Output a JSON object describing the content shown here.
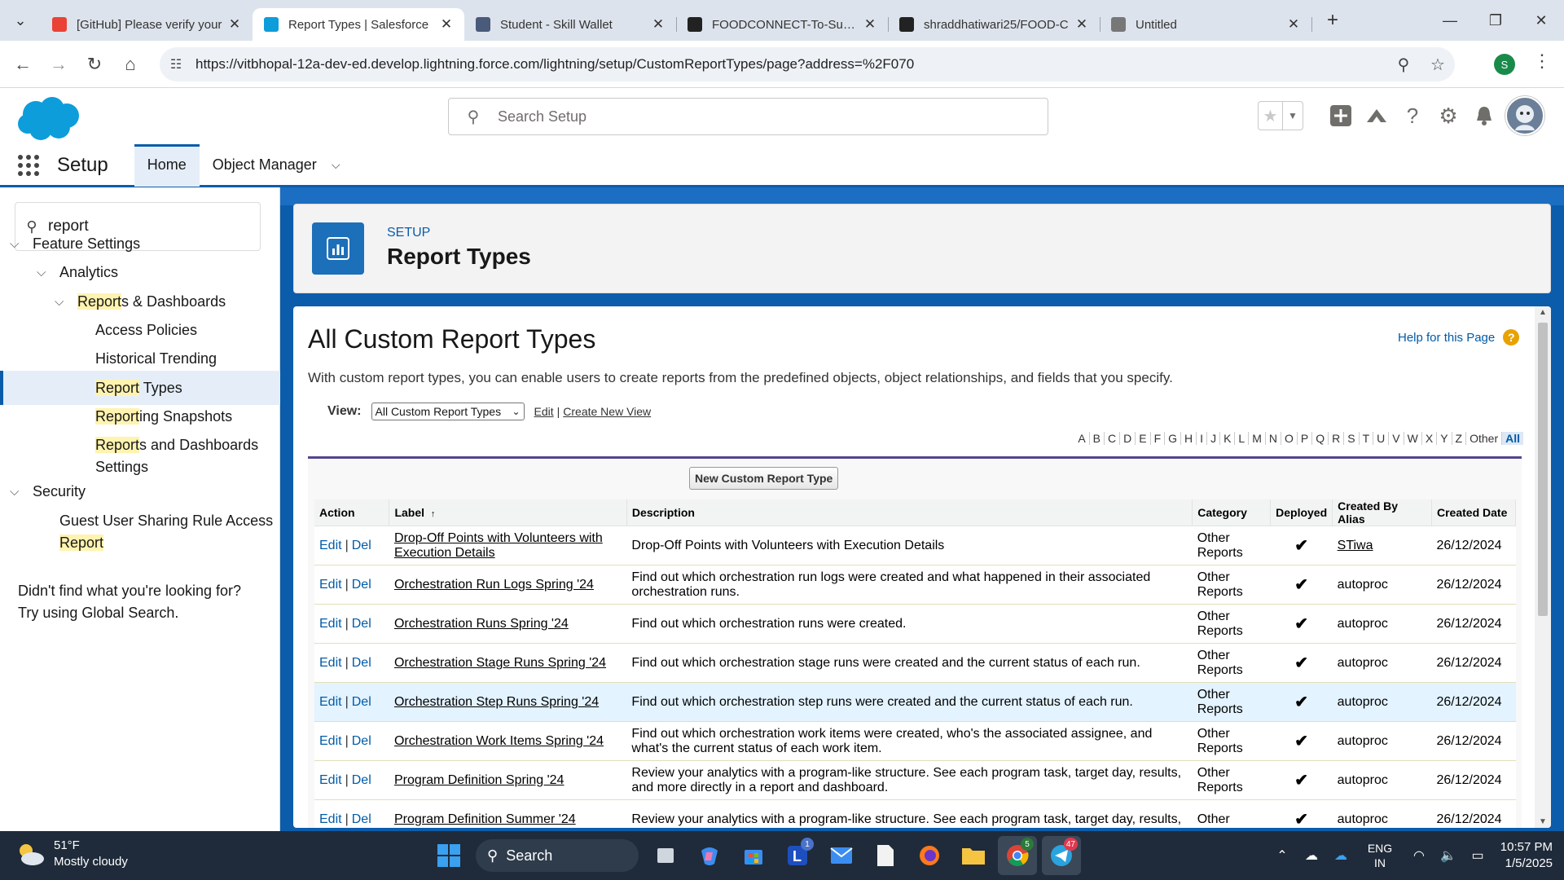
{
  "browser": {
    "tabs": [
      {
        "title": "[GitHub] Please verify your",
        "icon": "gmail-icon",
        "color": "#ea4335",
        "active": false
      },
      {
        "title": "Report Types | Salesforce",
        "icon": "salesforce-icon",
        "color": "#0d9dda",
        "active": true
      },
      {
        "title": "Student - Skill Wallet",
        "icon": "skill-wallet-icon",
        "color": "#4a5a7a",
        "active": false
      },
      {
        "title": "FOODCONNECT-To-Supply",
        "icon": "github-icon",
        "color": "#222222",
        "active": false
      },
      {
        "title": "shraddhatiwari25/FOOD-C",
        "icon": "github-icon",
        "color": "#222222",
        "active": false
      },
      {
        "title": "Untitled",
        "icon": "globe-icon",
        "color": "#777777",
        "active": false
      }
    ],
    "url": "https://vitbhopal-12a-dev-ed.develop.lightning.force.com/lightning/setup/CustomReportTypes/page?address=%2F070",
    "profile_initial": "S"
  },
  "sf": {
    "search_placeholder": "Search Setup",
    "app_name": "Setup",
    "nav_tabs": [
      {
        "label": "Home",
        "active": true
      },
      {
        "label": "Object Manager",
        "active": false
      }
    ],
    "accent": "#0b5cab"
  },
  "leftnav": {
    "quick_find": "report",
    "feature_settings": "Feature Settings",
    "analytics": "Analytics",
    "reports_dashboards_hl": "Report",
    "reports_dashboards_rest": "s & Dashboards",
    "access_policies": "Access Policies",
    "historical_trending": "Historical Trending",
    "report_types": "Report",
    "report_types_rest": " Types",
    "reporting_snapshots_hl": "Report",
    "reporting_snapshots_rest": "ing Snapshots",
    "reports_and_dash_hl": "Report",
    "reports_and_dash_rest": "s and Dashboards",
    "settings": "Settings",
    "security": "Security",
    "guest_user": "Guest User Sharing Rule Access",
    "guest_user_report": "Report",
    "no_help_1": "Didn't find what you're looking for?",
    "no_help_2": "Try using Global Search."
  },
  "page": {
    "breadcrumb": "SETUP",
    "title": "Report Types",
    "heading": "All Custom Report Types",
    "help_link": "Help for this Page",
    "intro": "With custom report types, you can enable users to create reports from the predefined objects, object relationships, and fields that you specify.",
    "view_label": "View:",
    "view_selected": "All Custom Report Types",
    "edit_link": "Edit",
    "create_view_link": "Create New View",
    "alphabet": [
      "A",
      "B",
      "C",
      "D",
      "E",
      "F",
      "G",
      "H",
      "I",
      "J",
      "K",
      "L",
      "M",
      "N",
      "O",
      "P",
      "Q",
      "R",
      "S",
      "T",
      "U",
      "V",
      "W",
      "X",
      "Y",
      "Z",
      "Other",
      "All"
    ],
    "new_button": "New Custom Report Type",
    "columns": {
      "action": "Action",
      "label": "Label",
      "sort_indicator": "↑",
      "description": "Description",
      "category": "Category",
      "deployed": "Deployed",
      "created_by": "Created By Alias",
      "created_date": "Created Date"
    },
    "action_edit": "Edit",
    "action_del": "Del",
    "action_sep": "|",
    "rows": [
      {
        "label": "Drop-Off Points with Volunteers with Execution Details",
        "description": "Drop-Off Points with Volunteers with Execution Details",
        "category": "Other Reports",
        "deployed": "✔",
        "created_by": "STiwa",
        "created_date": "26/12/2024"
      },
      {
        "label": "Orchestration Run Logs Spring '24",
        "description": "Find out which orchestration run logs were created and what happened in their associated orchestration runs.",
        "category": "Other Reports",
        "deployed": "✔",
        "created_by": "autoproc",
        "created_date": "26/12/2024"
      },
      {
        "label": "Orchestration Runs Spring '24",
        "description": "Find out which orchestration runs were created.",
        "category": "Other Reports",
        "deployed": "✔",
        "created_by": "autoproc",
        "created_date": "26/12/2024"
      },
      {
        "label": "Orchestration Stage Runs Spring '24",
        "description": "Find out which orchestration stage runs were created and the current status of each run.",
        "category": "Other Reports",
        "deployed": "✔",
        "created_by": "autoproc",
        "created_date": "26/12/2024"
      },
      {
        "label": "Orchestration Step Runs Spring '24",
        "description": "Find out which orchestration step runs were created and the current status of each run.",
        "category": "Other Reports",
        "deployed": "✔",
        "created_by": "autoproc",
        "created_date": "26/12/2024"
      },
      {
        "label": "Orchestration Work Items Spring '24",
        "description": "Find out which orchestration work items were created, who's the associated assignee, and what's the current status of each work item.",
        "category": "Other Reports",
        "deployed": "✔",
        "created_by": "autoproc",
        "created_date": "26/12/2024"
      },
      {
        "label": "Program Definition Spring '24",
        "description": "Review your analytics with a program-like structure. See each program task, target day, results, and more directly in a report and dashboard.",
        "category": "Other Reports",
        "deployed": "✔",
        "created_by": "autoproc",
        "created_date": "26/12/2024"
      },
      {
        "label": "Program Definition Summer '24",
        "description": "Review your analytics with a program-like structure. See each program task, target day, results,",
        "category": "Other",
        "deployed": "✔",
        "created_by": "autoproc",
        "created_date": "26/12/2024"
      }
    ]
  },
  "taskbar": {
    "temp": "51°F",
    "weather": "Mostly cloudy",
    "search": "Search",
    "lang1": "ENG",
    "lang2": "IN",
    "time": "10:57 PM",
    "date": "1/5/2025",
    "mail_badge": "1",
    "chrome_badge": "5",
    "telegram_badge": "47"
  }
}
